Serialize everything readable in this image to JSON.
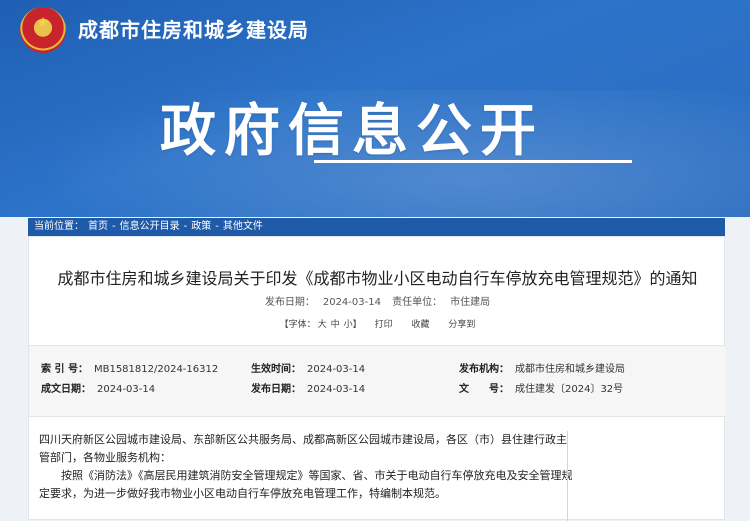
{
  "header": {
    "org_name": "成都市住房和城乡建设局",
    "hero_title": "政府信息公开"
  },
  "breadcrumb": {
    "label": "当前位置：",
    "items": [
      "首页",
      "信息公开目录",
      "政策",
      "其他文件"
    ],
    "separator": "-"
  },
  "document": {
    "title": "成都市住房和城乡建设局关于印发《成都市物业小区电动自行车停放充电管理规范》的通知",
    "publish_date_label": "发布日期：",
    "publish_date": "2024-03-14",
    "responsible_label": "责任单位：",
    "responsible": "市住建局",
    "tools": {
      "font_label": "【字体：",
      "font_large": "大",
      "font_medium": "中",
      "font_small": "小】",
      "print": "打印",
      "favorite": "收藏",
      "share": "分享到"
    }
  },
  "info": {
    "index_label": "索 引 号：",
    "index_value": "MB1581812/2024-16312",
    "effective_label": "生效时间：",
    "effective_value": "2024-03-14",
    "issuer_label": "发布机构：",
    "issuer_value": "成都市住房和城乡建设局",
    "created_label": "成文日期：",
    "created_value": "2024-03-14",
    "published_label": "发布日期：",
    "published_value": "2024-03-14",
    "docno_label": "文　　号：",
    "docno_value": "成住建发〔2024〕32号"
  },
  "content": {
    "recipients": "四川天府新区公园城市建设局、东部新区公共服务局、成都高新区公园城市建设局，各区（市）县住建行政主管部门，各物业服务机构：",
    "para1": "按照《消防法》《高层民用建筑消防安全管理规定》等国家、省、市关于电动自行车停放充电及安全管理规定要求，为进一步做好我市物业小区电动自行车停放充电管理工作，特编制本规范。"
  }
}
